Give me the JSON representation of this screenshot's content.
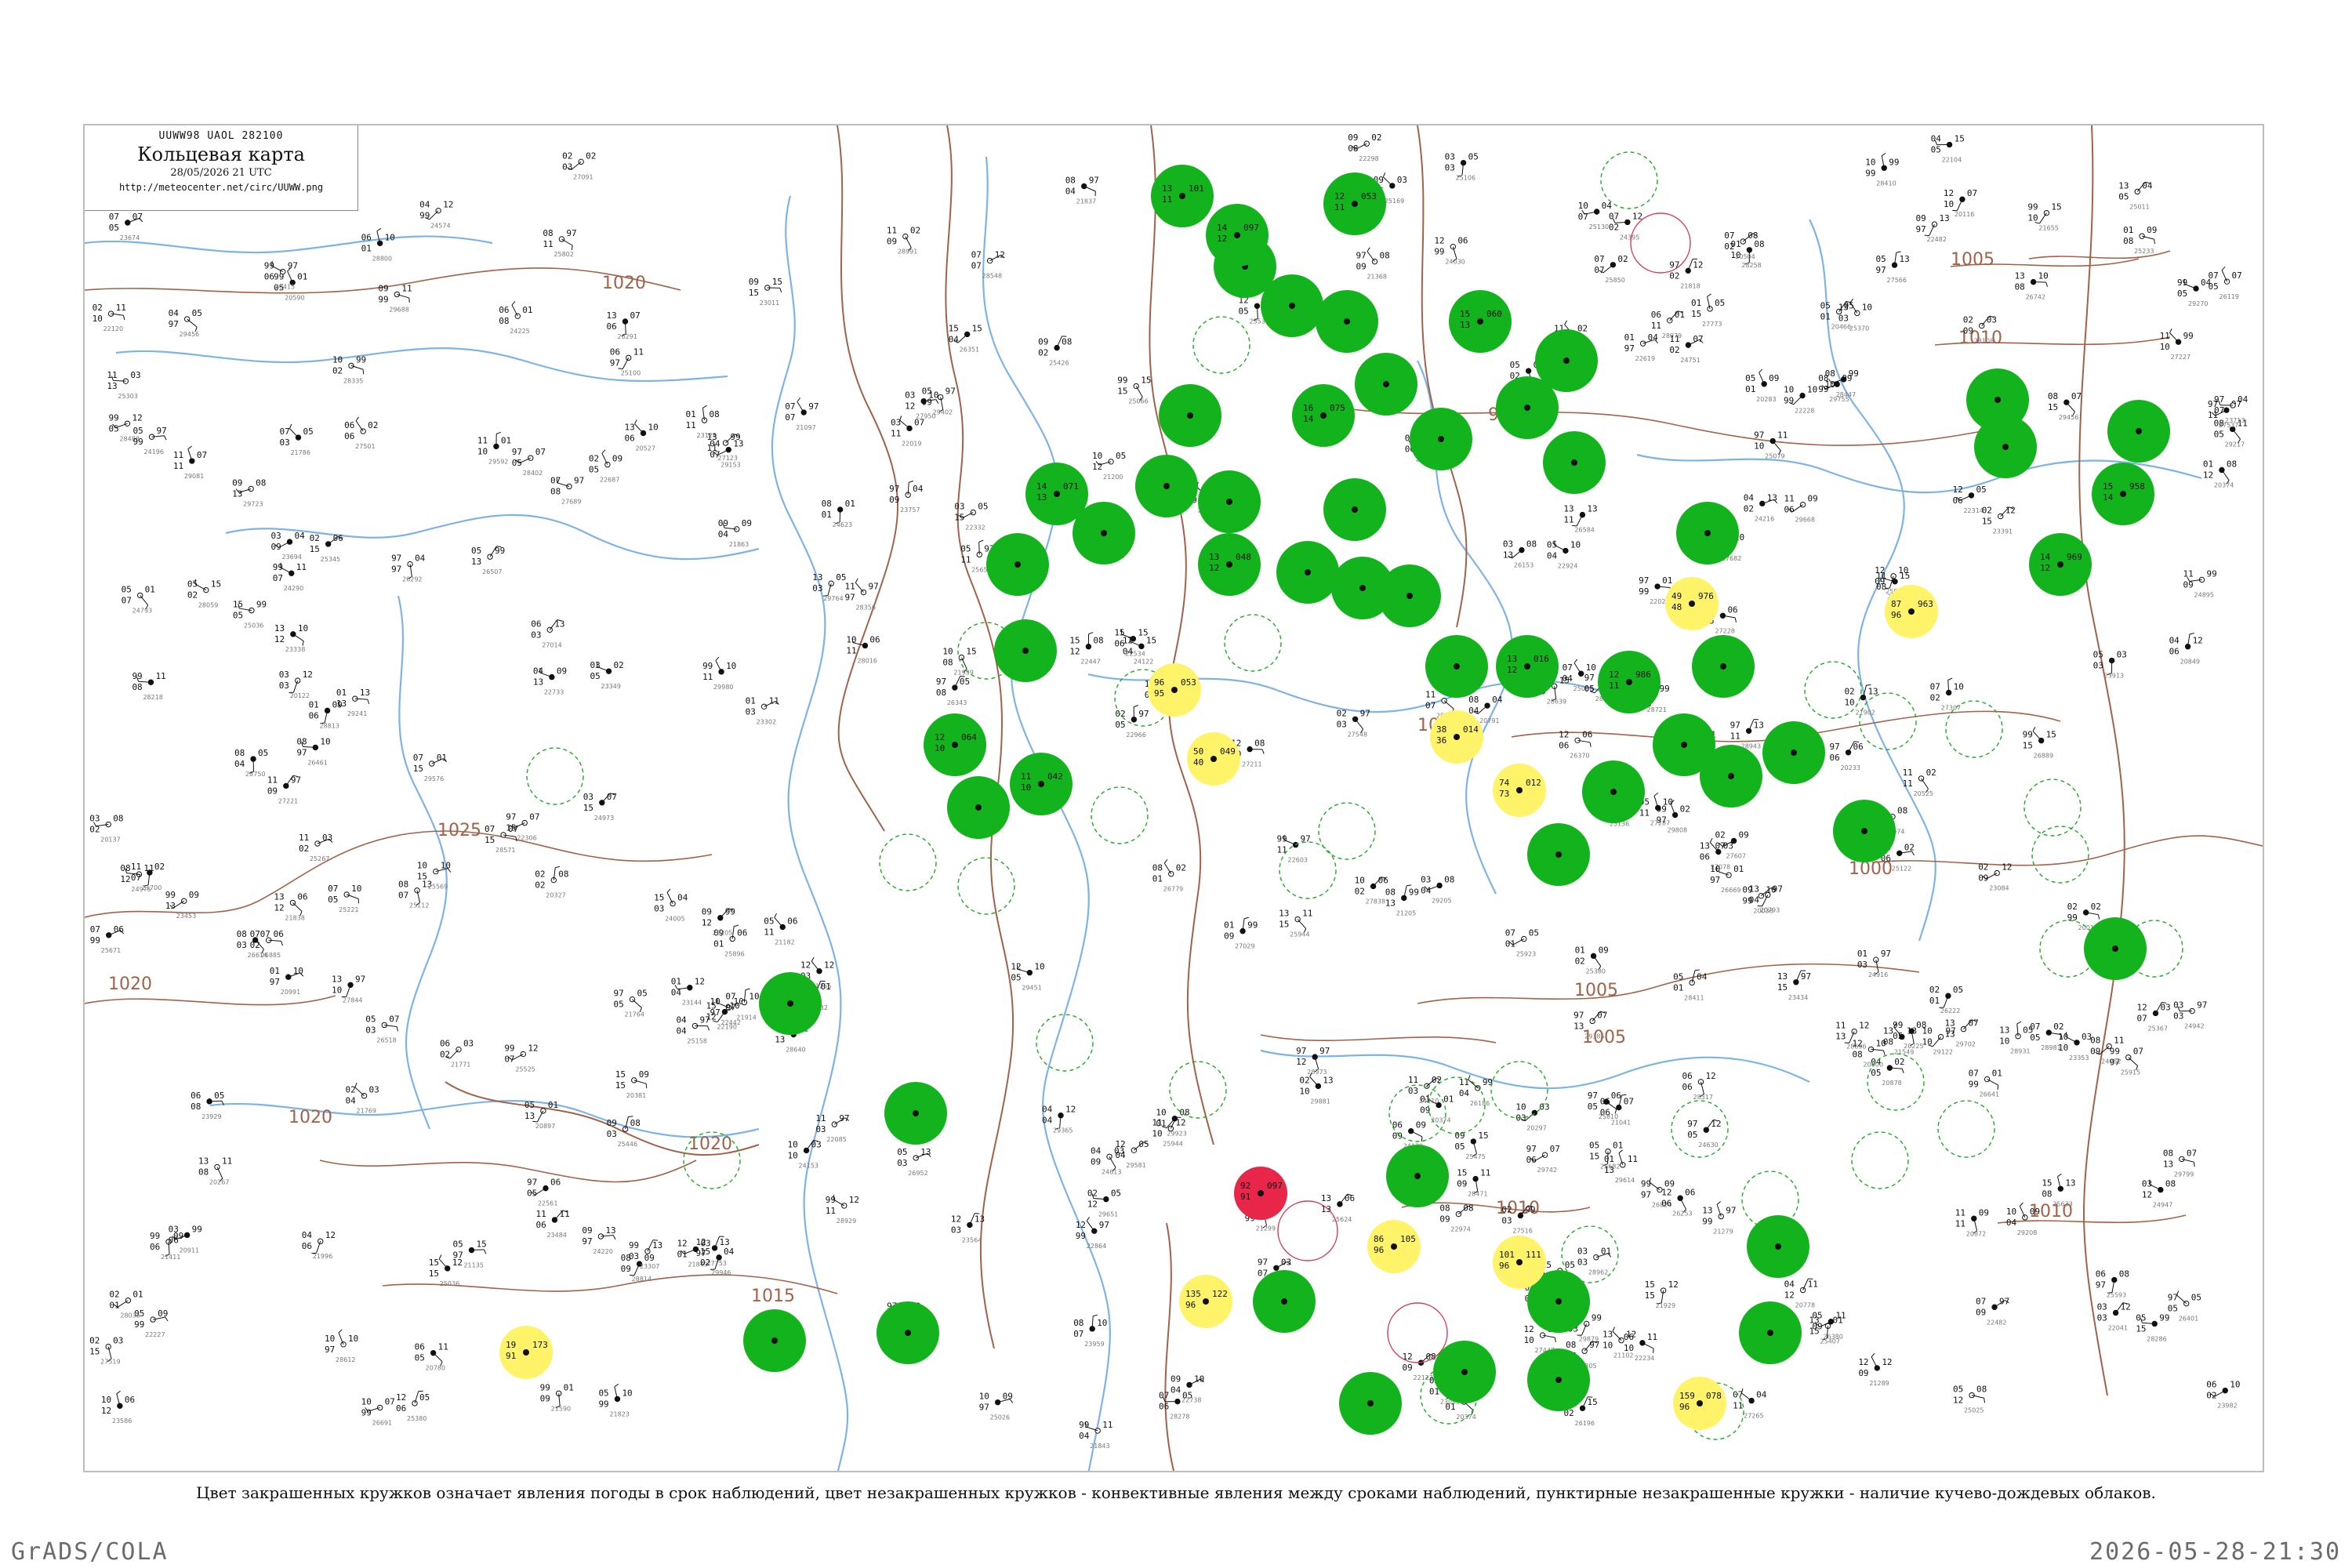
{
  "header": {
    "code_line": "UUWW98 UAOL 282100",
    "title": "Кольцевая карта",
    "date_line": "28/05/2026 21 UTC",
    "url": "http://meteocenter.net/circ/UUWW.png"
  },
  "caption": "Цвет закрашенных кружков означает явления погоды в срок наблюдений, цвет незакрашенных кружков - конвективные явления между сроками наблюдений, пунктирные незакрашенные кружки - наличие кучево-дождевых облаков.",
  "footer": {
    "brand": "GrADS/COLA",
    "timestamp": "2026-05-28-21:30"
  },
  "isobar_labels": [
    "1020",
    "1025",
    "1020",
    "1020",
    "1020",
    "1015",
    "1010",
    "1005",
    "1005",
    "1000",
    "1000",
    "995",
    "1005",
    "1010",
    "1010"
  ],
  "colors": {
    "isobar": "#a0634a",
    "river": "#7fb3e6",
    "border": "#a0634a",
    "rain": "#12b31c",
    "fog": "#fff36a",
    "storm": "#e8264a",
    "convective_ring": "#22aa22",
    "thunder_ring": "#d0405a"
  },
  "stations": [
    {
      "id": "s01",
      "kind": "rain",
      "t": "13",
      "td": "11",
      "p": "101"
    },
    {
      "id": "s02",
      "kind": "rain",
      "t": "14",
      "td": "12",
      "p": "097"
    },
    {
      "id": "s03",
      "kind": "rain",
      "t": "12",
      "td": "11",
      "p": "053"
    },
    {
      "id": "s04",
      "kind": "rain",
      "t": "15",
      "td": "13",
      "p": "060"
    },
    {
      "id": "s05",
      "kind": "rain",
      "t": "16",
      "td": "14",
      "p": "075"
    },
    {
      "id": "s06",
      "kind": "rain",
      "t": "13",
      "td": "12",
      "p": "048"
    },
    {
      "id": "s07",
      "kind": "rain",
      "t": "14",
      "td": "13",
      "p": "071"
    },
    {
      "id": "s08",
      "kind": "rain",
      "t": "12",
      "td": "10",
      "p": "064"
    },
    {
      "id": "s09",
      "kind": "rain",
      "t": "11",
      "td": "10",
      "p": "042"
    },
    {
      "id": "s10",
      "kind": "rain",
      "t": "13",
      "td": "12",
      "p": "016"
    },
    {
      "id": "s11",
      "kind": "rain",
      "t": "12",
      "td": "11",
      "p": "986"
    },
    {
      "id": "s12",
      "kind": "rain",
      "t": "14",
      "td": "12",
      "p": "969"
    },
    {
      "id": "s13",
      "kind": "rain",
      "t": "15",
      "td": "14",
      "p": "958"
    },
    {
      "id": "s14",
      "kind": "fog",
      "t": "96",
      "td": "95",
      "p": "053"
    },
    {
      "id": "s15",
      "kind": "fog",
      "t": "50",
      "td": "40",
      "p": "049"
    },
    {
      "id": "s16",
      "kind": "fog",
      "t": "38",
      "td": "36",
      "p": "014"
    },
    {
      "id": "s17",
      "kind": "fog",
      "t": "74",
      "td": "73",
      "p": "012"
    },
    {
      "id": "s18",
      "kind": "fog",
      "t": "49",
      "td": "48",
      "p": "976"
    },
    {
      "id": "s19",
      "kind": "fog",
      "t": "87",
      "td": "96",
      "p": "963"
    },
    {
      "id": "s20",
      "kind": "fog",
      "t": "19",
      "td": "91",
      "p": "173"
    },
    {
      "id": "s21",
      "kind": "fog",
      "t": "135",
      "td": "96",
      "p": "122"
    },
    {
      "id": "s22",
      "kind": "fog",
      "t": "86",
      "td": "96",
      "p": "105"
    },
    {
      "id": "s23",
      "kind": "fog",
      "t": "159",
      "td": "96",
      "p": "078"
    },
    {
      "id": "s24",
      "kind": "fog",
      "t": "101",
      "td": "96",
      "p": "111"
    },
    {
      "id": "s25",
      "kind": "storm",
      "t": "92",
      "td": "91",
      "p": "097"
    }
  ]
}
